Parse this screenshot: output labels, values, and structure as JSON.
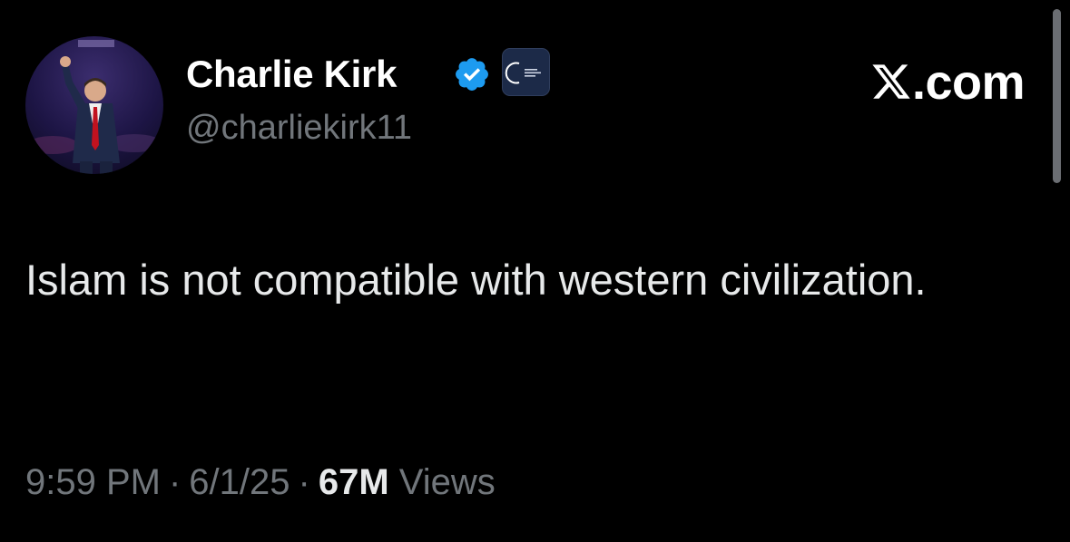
{
  "author": {
    "display_name": "Charlie Kirk",
    "handle": "@charliekirk11",
    "verified_icon": "verified-badge-icon",
    "affiliate_icon": "turning-point-usa-logo",
    "avatar": "profile-photo"
  },
  "brand": {
    "label": ".com",
    "logo_icon": "x-logo-icon"
  },
  "tweet": {
    "text": "Islam is not compatible with western civilization."
  },
  "meta": {
    "time": "9:59 PM",
    "separator": "·",
    "date": "6/1/25",
    "views_count": "67M",
    "views_label": "Views"
  },
  "colors": {
    "background": "#000000",
    "text": "#e7e9ea",
    "secondary": "#71767b",
    "verified": "#1d9bf0"
  }
}
